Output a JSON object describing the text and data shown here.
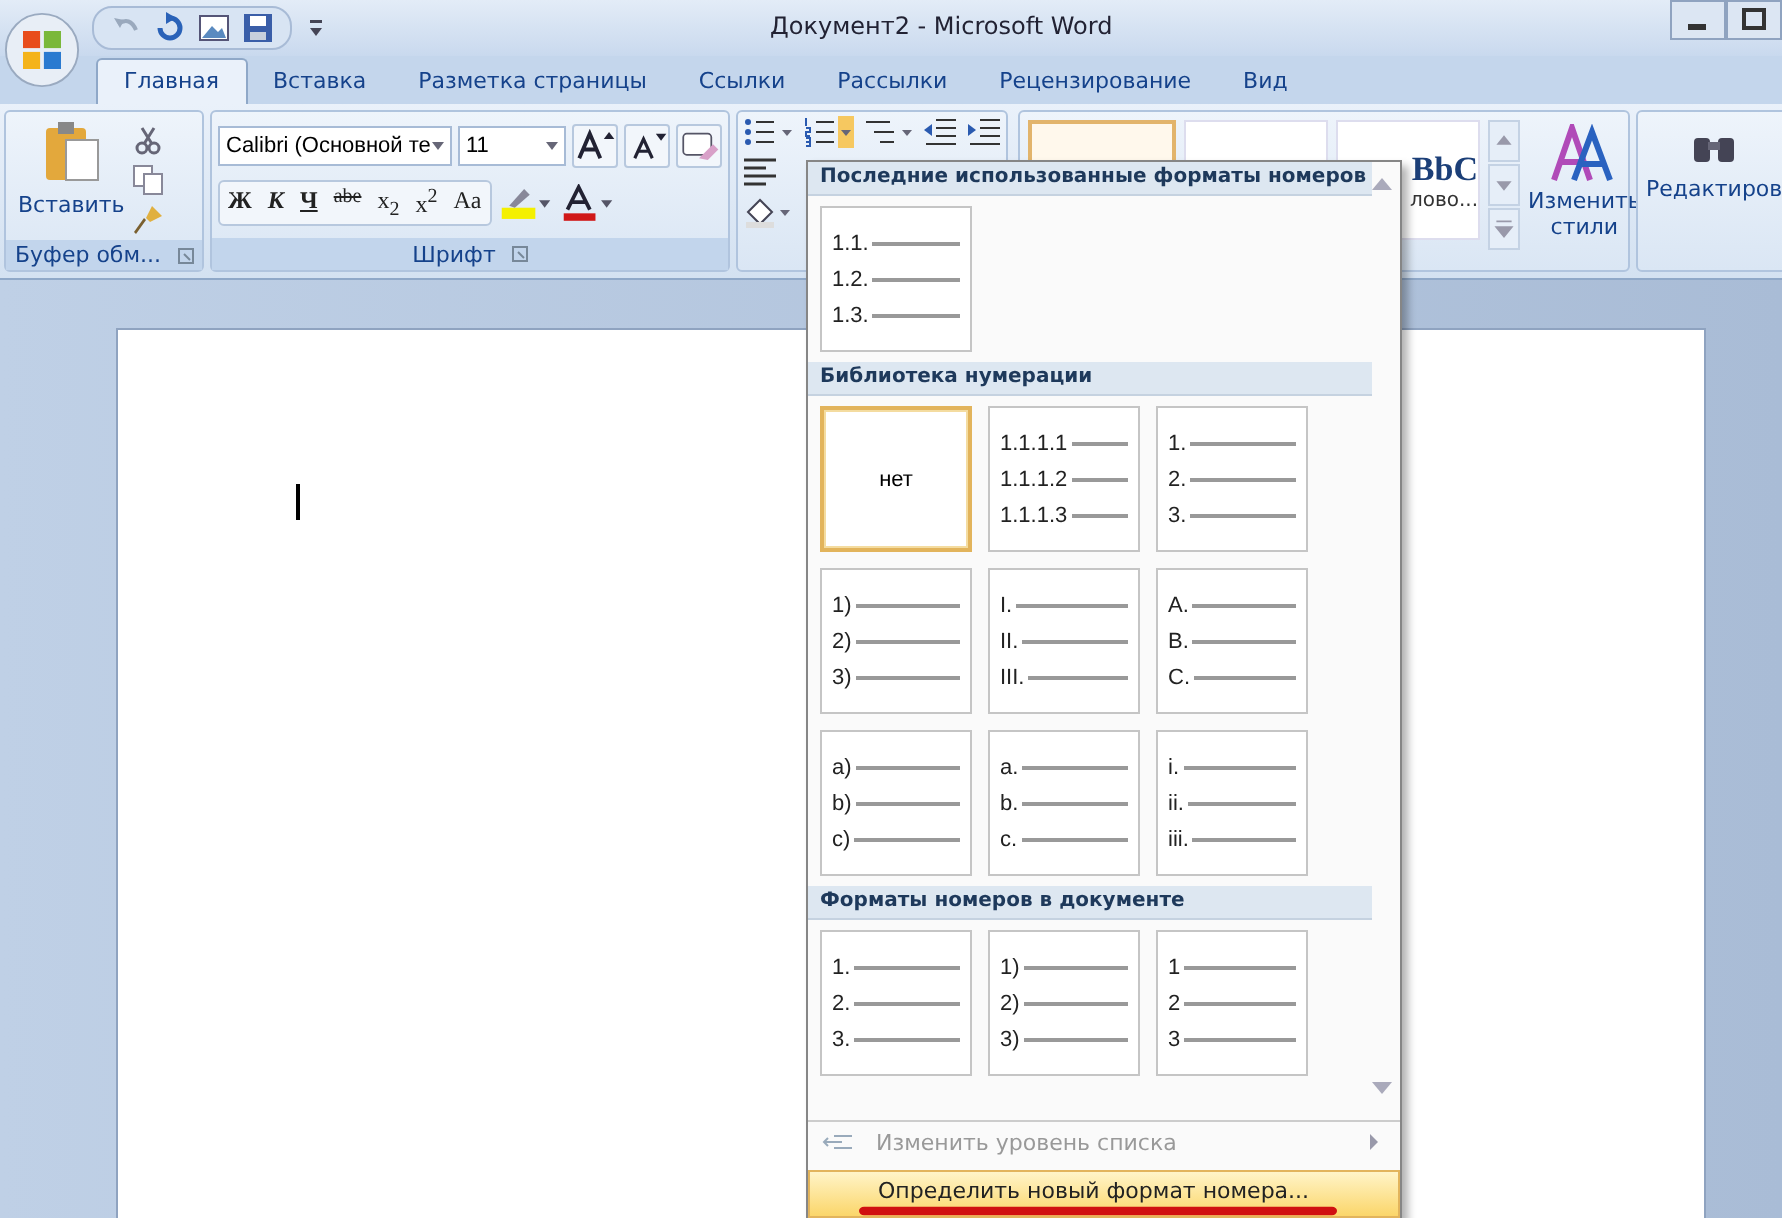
{
  "window": {
    "title": "Документ2 - Microsoft Word"
  },
  "tabs": [
    {
      "label": "Главная",
      "selected": true
    },
    {
      "label": "Вставка",
      "selected": false
    },
    {
      "label": "Разметка страницы",
      "selected": false
    },
    {
      "label": "Ссылки",
      "selected": false
    },
    {
      "label": "Рассылки",
      "selected": false
    },
    {
      "label": "Рецензирование",
      "selected": false
    },
    {
      "label": "Вид",
      "selected": false
    }
  ],
  "clipboard": {
    "paste": "Вставить",
    "group": "Буфер обм..."
  },
  "font": {
    "name": "Calibri (Основной те",
    "size": "11",
    "group": "Шрифт",
    "case_button": "Aa",
    "styles": [
      {
        "label": "Ж",
        "kind": "bold"
      },
      {
        "label": "К",
        "kind": "italic"
      },
      {
        "label": "Ч",
        "kind": "underline"
      },
      {
        "label": "abe",
        "kind": "strike"
      },
      {
        "label": "x$_{2}$",
        "kind": "plain"
      },
      {
        "label": "x$^{2}$",
        "kind": "plain"
      }
    ]
  },
  "styles": {
    "tiles": [
      {
        "selected": true
      },
      {
        "selected": false
      },
      {
        "sample": "BbC",
        "name": "лово...",
        "selected": false
      }
    ],
    "change": "Изменить стили"
  },
  "editing": {
    "label": "Редактиров"
  },
  "menu": {
    "sections": [
      {
        "title": "Последние использованные форматы номеров",
        "items": [
          {
            "lines": [
              "1.1.",
              "1.2.",
              "1.3."
            ],
            "selected": false
          }
        ]
      },
      {
        "title": "Библиотека нумерации",
        "items": [
          {
            "label": "нет",
            "selected": true
          },
          {
            "lines": [
              "1.1.1.1",
              "1.1.1.2",
              "1.1.1.3"
            ],
            "selected": false
          },
          {
            "lines": [
              "1.",
              "2.",
              "3."
            ],
            "selected": false
          },
          {
            "lines": [
              "1)",
              "2)",
              "3)"
            ],
            "selected": false
          },
          {
            "lines": [
              "I.",
              "II.",
              "III."
            ],
            "selected": false
          },
          {
            "lines": [
              "A.",
              "B.",
              "C."
            ],
            "selected": false
          },
          {
            "lines": [
              "a)",
              "b)",
              "c)"
            ],
            "selected": false
          },
          {
            "lines": [
              "a.",
              "b.",
              "c."
            ],
            "selected": false
          },
          {
            "lines": [
              "i.",
              "ii.",
              "iii."
            ],
            "selected": false
          }
        ]
      },
      {
        "title": "Форматы номеров в документе",
        "items": [
          {
            "lines": [
              "1.",
              "2.",
              "3."
            ],
            "selected": false
          },
          {
            "lines": [
              "1)",
              "2)",
              "3)"
            ],
            "selected": false
          },
          {
            "lines": [
              "1",
              "2",
              "3"
            ],
            "selected": false
          }
        ]
      }
    ],
    "commands": [
      {
        "label": "Изменить уровень списка",
        "disabled": true,
        "submenu": true,
        "highlighted": false,
        "marked": false
      },
      {
        "label": "Определить новый формат номера...",
        "disabled": false,
        "submenu": false,
        "highlighted": true,
        "marked": true
      }
    ]
  }
}
